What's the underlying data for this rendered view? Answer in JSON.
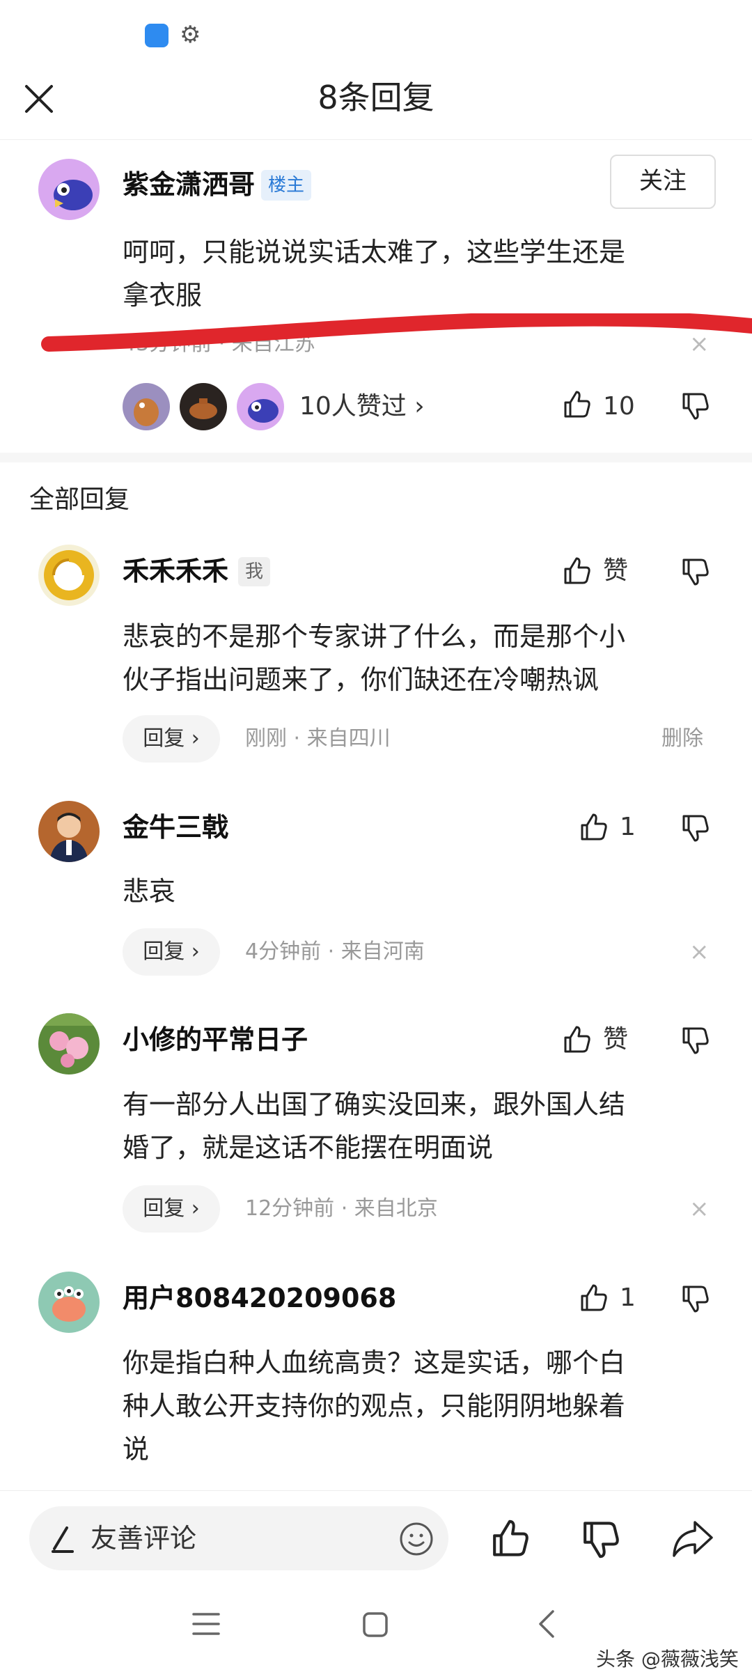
{
  "header": {
    "title": "8条回复"
  },
  "post": {
    "author": "紫金潇洒哥",
    "owner_tag": "楼主",
    "follow_label": "关注",
    "text_line1": "呵呵，只能说说实话太难了，这些学生还是",
    "text_line2": "拿衣服",
    "meta": "43分钟前 · 来自江苏",
    "likes_summary": "10人赞过 ›",
    "like_count": "10"
  },
  "section": {
    "title": "全部回复"
  },
  "replies": [
    {
      "author": "禾禾禾禾",
      "tag": "我",
      "like_label": "赞",
      "text_line1": "悲哀的不是那个专家讲了什么，而是那个小",
      "text_line2": "伙子指出问题来了，你们缺还在冷嘲热讽",
      "reply_label": "回复 ›",
      "meta": "刚刚 · 来自四川",
      "delete_label": "删除"
    },
    {
      "author": "金牛三戟",
      "like_label": "1",
      "text_line1": "悲哀",
      "reply_label": "回复 ›",
      "meta": "4分钟前 · 来自河南"
    },
    {
      "author": "小修的平常日子",
      "like_label": "赞",
      "text_line1": "有一部分人出国了确实没回来，跟外国人结",
      "text_line2": "婚了，就是这话不能摆在明面说",
      "reply_label": "回复 ›",
      "meta": "12分钟前 · 来自北京"
    },
    {
      "author": "用户808420209068",
      "like_label": "1",
      "text_line1": "你是指白种人血统高贵？这是实话，哪个白",
      "text_line2": "种人敢公开支持你的观点，只能阴阴地躲着",
      "text_line3": "说"
    }
  ],
  "bottom": {
    "comment_placeholder": "友善评论"
  },
  "watermark": "头条 @薇薇浅笑",
  "colors": {
    "accent": "#2a7ad6",
    "red_mark": "#e0262c",
    "muted": "#999999"
  }
}
